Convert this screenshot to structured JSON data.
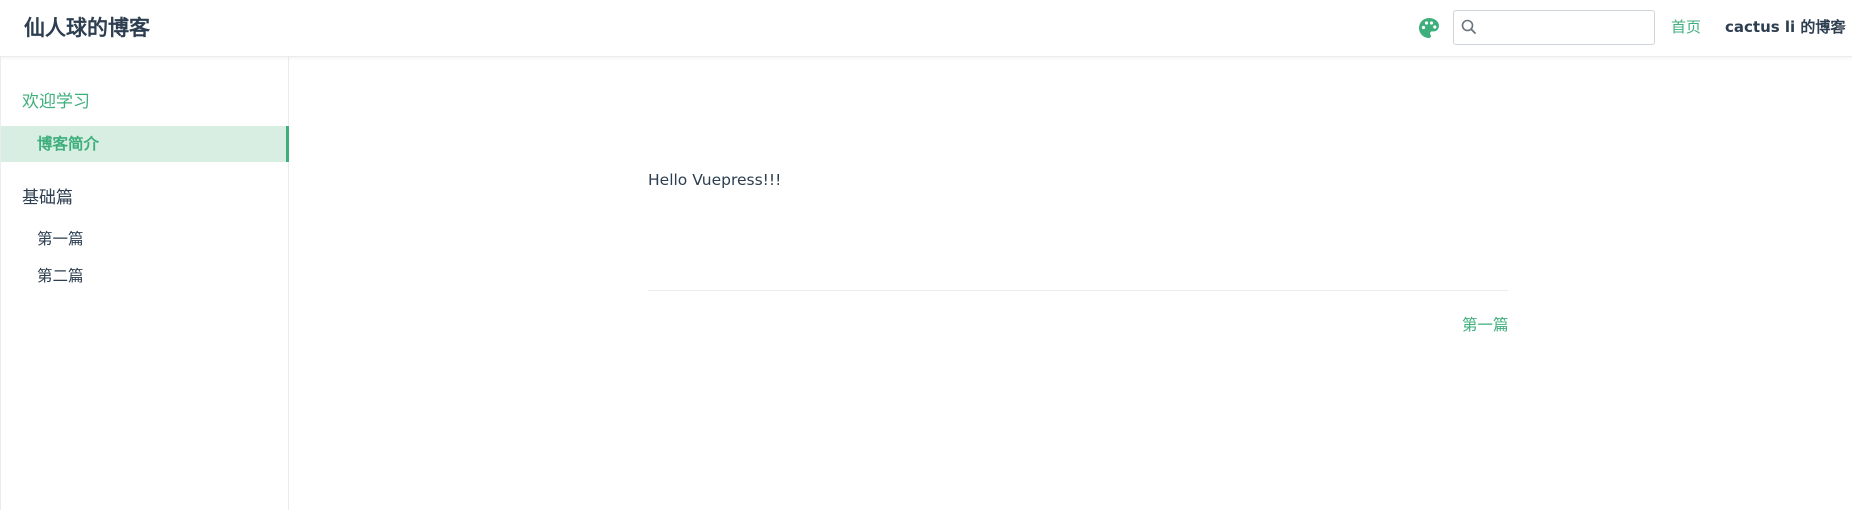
{
  "navbar": {
    "site_title": "仙人球的博客",
    "palette_icon": "palette-icon",
    "search": {
      "placeholder": "",
      "value": "",
      "icon": "search-icon"
    },
    "links": {
      "home": "首页",
      "dropdown": "cactus li 的博客"
    },
    "accent_color": "#3eaf7c"
  },
  "sidebar": {
    "groups": [
      {
        "title": "欢迎学习",
        "active": true,
        "items": [
          {
            "label": "博客简介",
            "active": true
          }
        ]
      },
      {
        "title": "基础篇",
        "active": false,
        "items": [
          {
            "label": "第一篇",
            "active": false
          },
          {
            "label": "第二篇",
            "active": false
          }
        ]
      }
    ]
  },
  "main": {
    "content": "Hello Vuepress!!!",
    "next_link": "第一篇"
  }
}
